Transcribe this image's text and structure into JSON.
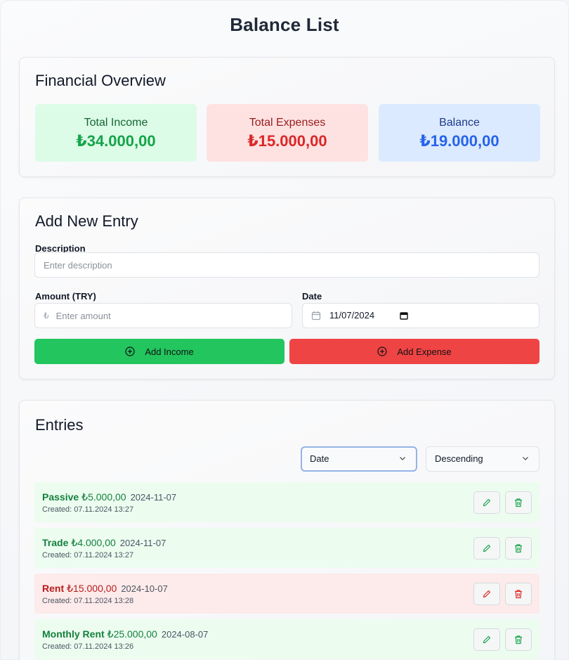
{
  "app": {
    "title": "Balance List"
  },
  "overview": {
    "heading": "Financial Overview",
    "income": {
      "label": "Total Income",
      "value": "₺34.000,00"
    },
    "expenses": {
      "label": "Total Expenses",
      "value": "₺15.000,00"
    },
    "balance": {
      "label": "Balance",
      "value": "₺19.000,00"
    }
  },
  "add_entry": {
    "heading": "Add New Entry",
    "description": {
      "label": "Description",
      "placeholder": "Enter description",
      "value": ""
    },
    "amount": {
      "label": "Amount (TRY)",
      "prefix": "₺",
      "placeholder": "Enter amount",
      "value": ""
    },
    "date": {
      "label": "Date",
      "value": "11/07/2024"
    },
    "add_income_label": "Add Income",
    "add_expense_label": "Add Expense"
  },
  "entries": {
    "heading": "Entries",
    "sort_field": "Date",
    "sort_order": "Descending",
    "items": [
      {
        "name": "Passive",
        "amount": "₺5.000,00",
        "date": "2024-11-07",
        "created": "Created: 07.11.2024 13:27",
        "type": "income"
      },
      {
        "name": "Trade",
        "amount": "₺4.000,00",
        "date": "2024-11-07",
        "created": "Created: 07.11.2024 13:27",
        "type": "income"
      },
      {
        "name": "Rent",
        "amount": "₺15.000,00",
        "date": "2024-10-07",
        "created": "Created: 07.11.2024 13:28",
        "type": "expense"
      },
      {
        "name": "Monthly Rent",
        "amount": "₺25.000,00",
        "date": "2024-08-07",
        "created": "Created: 07.11.2024 13:26",
        "type": "income"
      }
    ]
  },
  "colors": {
    "income": "#16a34a",
    "expense": "#dc2626",
    "balance": "#2563eb",
    "income_button": "#22c55e",
    "expense_button": "#ef4444"
  },
  "icons": {
    "add": "plus-circle-icon",
    "calendar": "calendar-icon",
    "edit": "pencil-icon",
    "delete": "trash-icon",
    "chevron": "chevron-down-icon"
  }
}
